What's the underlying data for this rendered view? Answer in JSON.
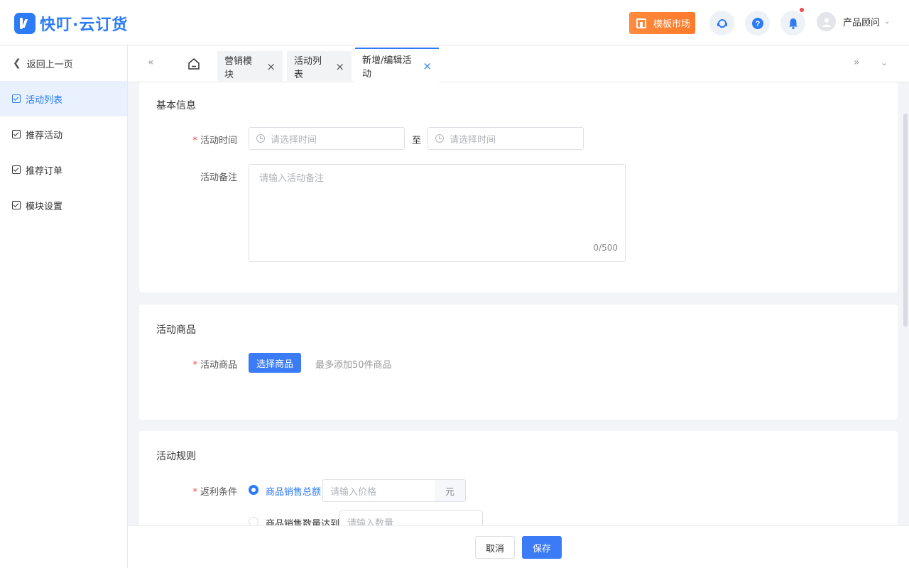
{
  "app": {
    "title": "快叮·云订货"
  },
  "header": {
    "template_market": "模板市场",
    "user_name": "产品顾问",
    "icons": [
      "headset-icon",
      "help-icon",
      "bell-icon"
    ],
    "accent_color": "#2d7cf6",
    "notification_dot_color": "#f5484c"
  },
  "sidebar": {
    "back_label": "返回上一页",
    "items": [
      {
        "label": "活动列表",
        "active": true
      },
      {
        "label": "推荐活动"
      },
      {
        "label": "推荐订单"
      },
      {
        "label": "模块设置"
      }
    ]
  },
  "tabs": [
    {
      "label": "营销模块"
    },
    {
      "label": "活动列表"
    },
    {
      "label": "新增/编辑活动",
      "active": true
    }
  ],
  "basic": {
    "title": "基本信息",
    "time_label": "活动时间",
    "start_placeholder": "请选择时间",
    "to": "至",
    "end_placeholder": "请选择时间",
    "remark_label": "活动备注",
    "remark_placeholder": "请输入活动备注",
    "remark_count": "0/500"
  },
  "goods": {
    "title": "活动商品",
    "label": "活动商品",
    "select_button": "选择商品",
    "hint": "最多添加50件商品"
  },
  "rules": {
    "title": "活动规则",
    "label": "返利条件",
    "option1": "商品销售总额",
    "price_placeholder": "请输入价格",
    "unit": "元",
    "option2": "商品销售数量达到",
    "qty_placeholder": "请输入数量"
  },
  "footer": {
    "cancel": "取消",
    "save": "保存"
  }
}
